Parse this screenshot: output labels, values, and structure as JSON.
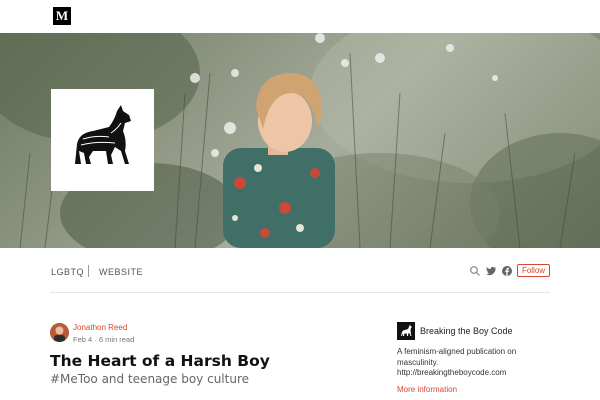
{
  "brand": {
    "logo_letter": "M"
  },
  "publication": {
    "nav": [
      "LGBTQ",
      "WEBSITE"
    ],
    "follow_label": "Follow",
    "name": "Breaking the Boy Code",
    "description": "A feminism-aligned publication on masculinity. http://breakingtheboycode.com",
    "more_info": "More information"
  },
  "article": {
    "author": "Jonathon Reed",
    "meta": "Feb 4 · 6 min read",
    "title": "The Heart of a Harsh Boy",
    "subtitle": "#MeToo and teenage boy culture"
  },
  "icons": [
    "search-icon",
    "twitter-icon",
    "facebook-icon",
    "howling-wolf-icon"
  ],
  "colors": {
    "accent": "#d9462f"
  }
}
